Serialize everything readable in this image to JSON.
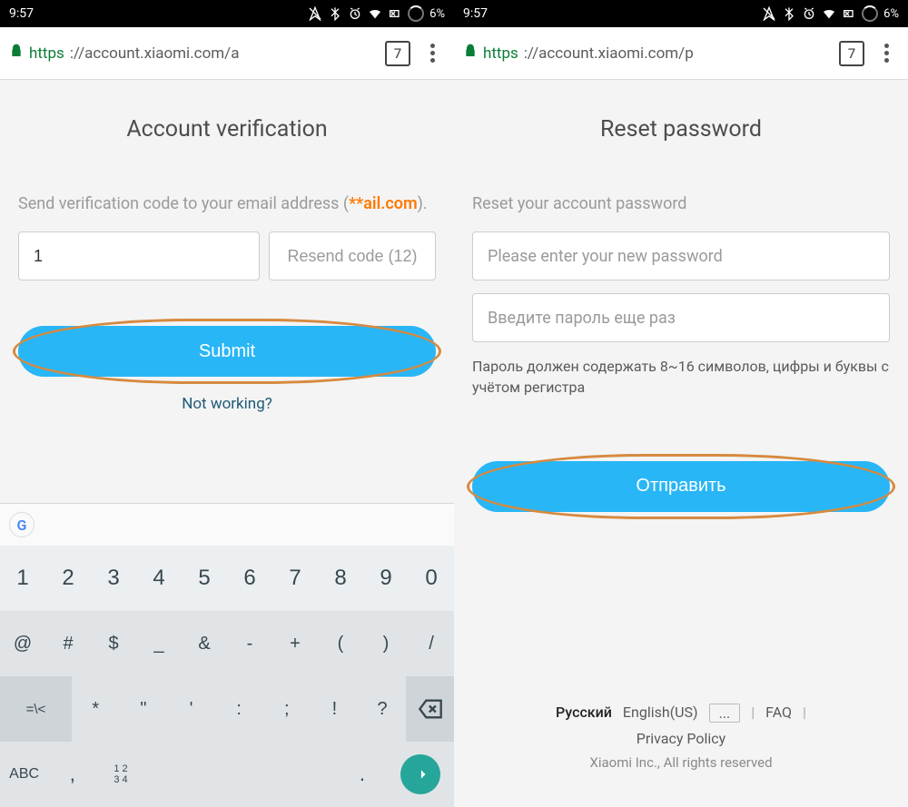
{
  "status": {
    "time": "9:57",
    "battery": "6%"
  },
  "left": {
    "url_scheme": "https",
    "url_rest": "://account.xiaomi.com/a",
    "tab_count": "7",
    "title": "Account verification",
    "instruction_text": "Send verification code to your email address (",
    "instruction_email": "**ail.com",
    "instruction_close": ").",
    "code_value": "1",
    "resend_label": "Resend code (12)",
    "submit_label": "Submit",
    "not_working": "Not working?"
  },
  "right": {
    "url_scheme": "https",
    "url_rest": "://account.xiaomi.com/p",
    "tab_count": "7",
    "title": "Reset password",
    "instruction_text": "Reset your account password",
    "new_pw_placeholder": "Please enter your new password",
    "confirm_pw_placeholder": "Введите пароль еще раз",
    "hint": "Пароль должен содержать 8~16 символов, цифры и буквы с учётом регистра",
    "submit_label": "Отправить",
    "footer": {
      "lang_current": "Русский",
      "lang_en": "English(US)",
      "lang_more": "...",
      "faq": "FAQ",
      "privacy": "Privacy Policy",
      "copyright": "Xiaomi Inc., All rights reserved"
    }
  },
  "keyboard": {
    "row1": [
      "1",
      "2",
      "3",
      "4",
      "5",
      "6",
      "7",
      "8",
      "9",
      "0"
    ],
    "row2": [
      "@",
      "#",
      "$",
      "_",
      "&",
      "-",
      "+",
      "(",
      ")",
      "/"
    ],
    "row3": [
      "*",
      "\"",
      "'",
      ":",
      ";",
      "!",
      "?"
    ],
    "sym_toggle": "=\\<",
    "abc": "ABC",
    "nums": "1 2\n3 4"
  }
}
